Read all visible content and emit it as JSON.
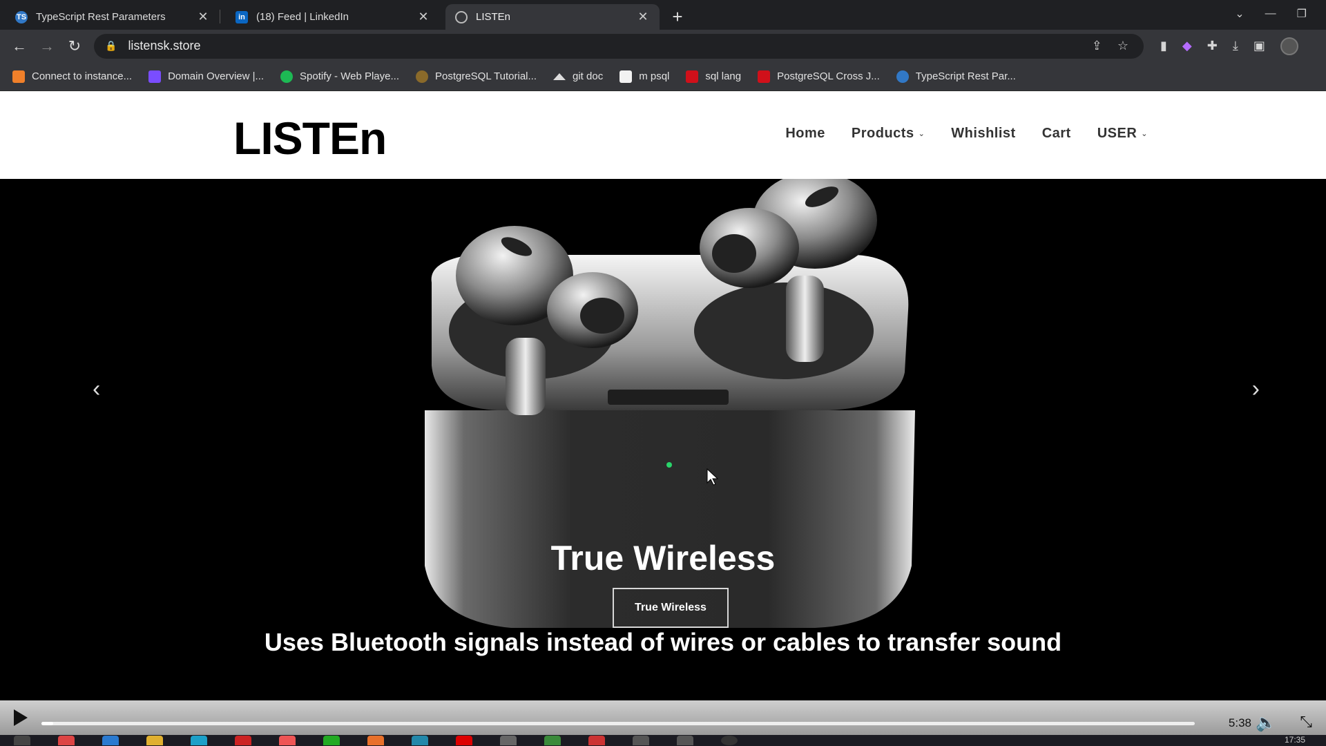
{
  "browser": {
    "tabs": [
      {
        "title": "TypeScript Rest Parameters",
        "favicon": "typescript-icon",
        "active": false
      },
      {
        "title": "(18) Feed | LinkedIn",
        "favicon": "linkedin-icon",
        "active": false
      },
      {
        "title": "LISTEn",
        "favicon": "globe-icon",
        "active": true
      }
    ],
    "new_tab": "+",
    "url": "listensk.store",
    "bookmarks": [
      {
        "label": "Connect to instance...",
        "color": "#f0802a"
      },
      {
        "label": "Domain Overview |...",
        "color": "#7a4dff"
      },
      {
        "label": "Spotify - Web Playe...",
        "color": "#1db954"
      },
      {
        "label": "PostgreSQL Tutorial...",
        "color": "#8a6a2a"
      },
      {
        "label": "git doc",
        "color": "#dddddd"
      },
      {
        "label": "m psql",
        "color": "#f2f2f2"
      },
      {
        "label": "sql lang",
        "color": "#d0101a"
      },
      {
        "label": "PostgreSQL Cross J...",
        "color": "#d0101a"
      },
      {
        "label": "TypeScript Rest Par...",
        "color": "#3178c6"
      }
    ]
  },
  "site": {
    "logo": "LISTEn",
    "nav": {
      "home": "Home",
      "products": "Products",
      "wishlist": "Whishlist",
      "cart": "Cart",
      "user": "USER"
    },
    "hero": {
      "title": "True Wireless",
      "button": "True Wireless",
      "subtitle": "Uses Bluetooth signals instead of wires or cables to transfer sound"
    }
  },
  "player": {
    "time": "5:38",
    "progress_fraction": 0.01
  },
  "taskbar": {
    "clock": "17:35"
  }
}
